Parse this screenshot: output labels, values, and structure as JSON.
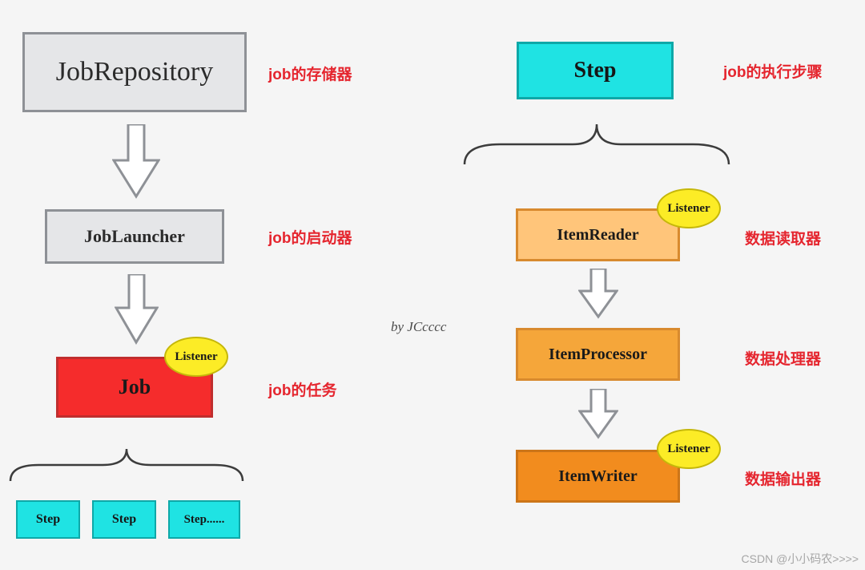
{
  "boxes": {
    "job_repository": "JobRepository",
    "job_launcher": "JobLauncher",
    "job": "Job",
    "step_main": "Step",
    "item_reader": "ItemReader",
    "item_processor": "ItemProcessor",
    "item_writer": "ItemWriter",
    "step_small_1": "Step",
    "step_small_2": "Step",
    "step_small_3": "Step......"
  },
  "listener_label": "Listener",
  "captions": {
    "job_repository": "job的存储器",
    "job_launcher": "job的启动器",
    "job": "job的任务",
    "step_main": "job的执行步骤",
    "item_reader": "数据读取器",
    "item_processor": "数据处理器",
    "item_writer": "数据输出器"
  },
  "author": "by JCcccc",
  "watermark": "CSDN @小小码农>>>>"
}
